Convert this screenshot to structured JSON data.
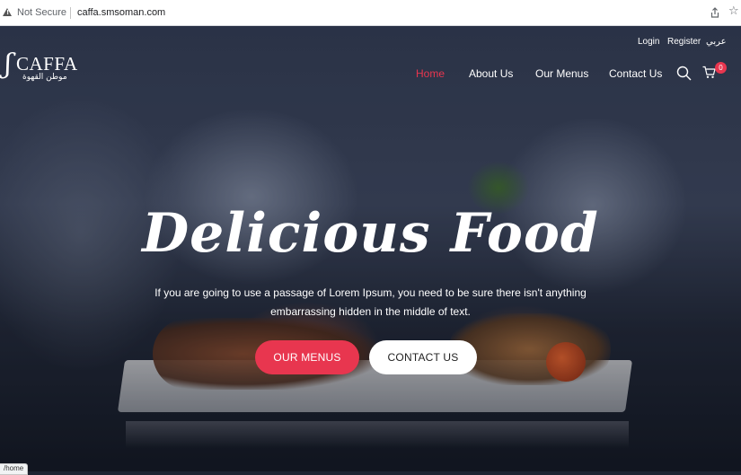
{
  "browser": {
    "security_label": "Not Secure",
    "url": "caffa.smsoman.com",
    "icons": [
      "warning-icon",
      "share-icon",
      "star-icon"
    ]
  },
  "header": {
    "logo_text": "CAFFA",
    "logo_arabic": "موطن القهوة",
    "top_links": {
      "login": "Login",
      "register": "Register",
      "language": "عربي"
    },
    "nav": [
      {
        "label": "Home",
        "active": true
      },
      {
        "label": "About Us",
        "active": false
      },
      {
        "label": "Our Menus",
        "active": false
      },
      {
        "label": "Contact Us",
        "active": false
      }
    ],
    "cart_count": "0",
    "icons": [
      "search-icon",
      "cart-icon"
    ]
  },
  "hero": {
    "title": "Delicious Food",
    "subtitle_line1": "If you are going to use a passage of Lorem Ipsum, you need to be sure there isn't anything",
    "subtitle_line2": "embarrassing hidden in the middle of text.",
    "primary_button": "OUR MENUS",
    "secondary_button": "CONTACT US"
  },
  "status_bar": {
    "text": "/home"
  },
  "colors": {
    "accent": "#e8364f",
    "text_light": "#ffffff",
    "button_light": "#ffffff"
  }
}
